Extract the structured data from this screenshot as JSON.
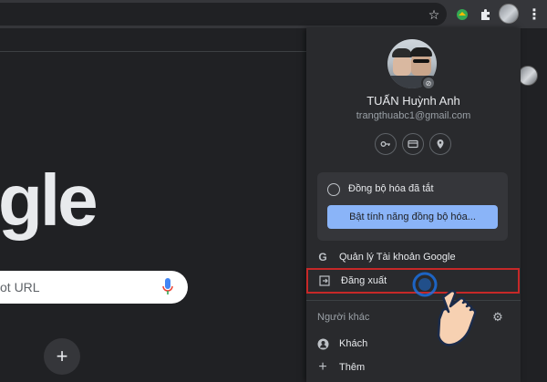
{
  "toolbar": {
    "bookmark_icon": "star-icon",
    "extensions_icon": "puzzle-icon",
    "menu_icon": "kebab-icon"
  },
  "ntp": {
    "logo_text": "gle",
    "search_placeholder": "ot URL",
    "add_shortcut": "+"
  },
  "profile": {
    "name": "TUẤN Huỳnh Anh",
    "email": "trangthuabc1@gmail.com",
    "quick_icons": [
      "key-icon",
      "card-icon",
      "location-icon"
    ],
    "sync_status": "Đồng bộ hóa đã tắt",
    "sync_button": "Bật tính năng đồng bộ hóa...",
    "manage_account": "Quản lý Tài khoản Google",
    "manage_icon_text": "G",
    "sign_out": "Đăng xuất",
    "other_people": "Người khác",
    "guest": "Khách",
    "add": "Thêm"
  },
  "colors": {
    "accent_button": "#8ab4f8",
    "highlight_border": "#c62828",
    "panel_bg": "#292a2d"
  }
}
